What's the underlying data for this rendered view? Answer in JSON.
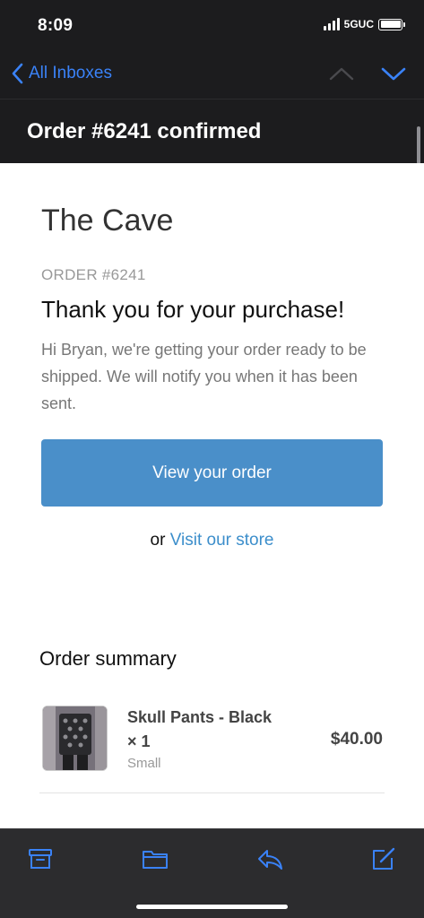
{
  "status_bar": {
    "time": "8:09",
    "network": "5GUC"
  },
  "nav": {
    "back_label": "All Inboxes"
  },
  "email": {
    "subject": "Order #6241 confirmed",
    "store_name": "The Cave",
    "order_number": "ORDER #6241",
    "heading": "Thank you for your purchase!",
    "message": "Hi Bryan, we're getting your order ready to be shipped. We will notify you when it has been sent.",
    "button_label": "View your order",
    "or_text": "or",
    "store_link": "Visit our store",
    "summary_title": "Order summary",
    "item": {
      "name": "Skull Pants - Black × 1",
      "variant": "Small",
      "price": "$40.00"
    }
  },
  "icons": [
    "chevron-left-icon",
    "chevron-up-icon",
    "chevron-down-icon",
    "archive-icon",
    "folder-icon",
    "reply-icon",
    "compose-icon"
  ],
  "colors": {
    "accent": "#3a82f7",
    "button": "#4a8fc9",
    "link": "#3c8ecb"
  }
}
